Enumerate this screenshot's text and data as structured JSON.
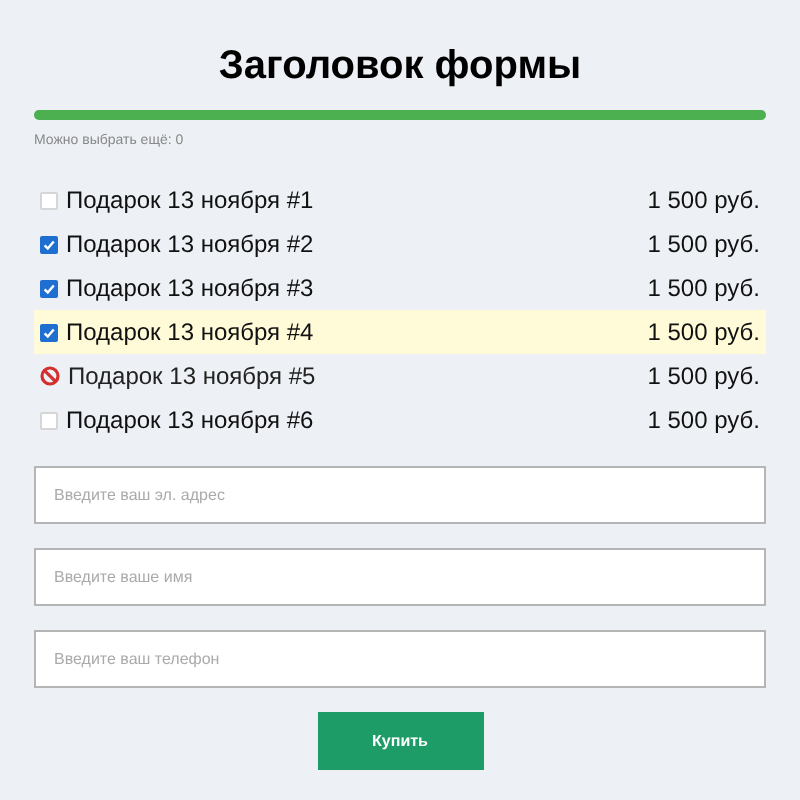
{
  "title": "Заголовок формы",
  "progress": {
    "level": 1
  },
  "remaining": "Можно выбрать ещё: 0",
  "items": [
    {
      "label": "Подарок 13 ноября #1",
      "price": "1 500 руб.",
      "checked": false,
      "disabled": false,
      "highlighted": false
    },
    {
      "label": "Подарок 13 ноября #2",
      "price": "1 500 руб.",
      "checked": true,
      "disabled": false,
      "highlighted": false
    },
    {
      "label": "Подарок 13 ноября #3",
      "price": "1 500 руб.",
      "checked": true,
      "disabled": false,
      "highlighted": false
    },
    {
      "label": "Подарок 13 ноября #4",
      "price": "1 500 руб.",
      "checked": true,
      "disabled": false,
      "highlighted": true
    },
    {
      "label": "Подарок 13 ноября #5",
      "price": "1 500 руб.",
      "checked": false,
      "disabled": true,
      "highlighted": false
    },
    {
      "label": "Подарок 13 ноября #6",
      "price": "1 500 руб.",
      "checked": false,
      "disabled": false,
      "highlighted": false
    }
  ],
  "fields": [
    {
      "placeholder": "Введите ваш эл. адрес"
    },
    {
      "placeholder": "Введите ваше имя"
    },
    {
      "placeholder": "Введите ваш телефон"
    }
  ],
  "submit": "Купить"
}
